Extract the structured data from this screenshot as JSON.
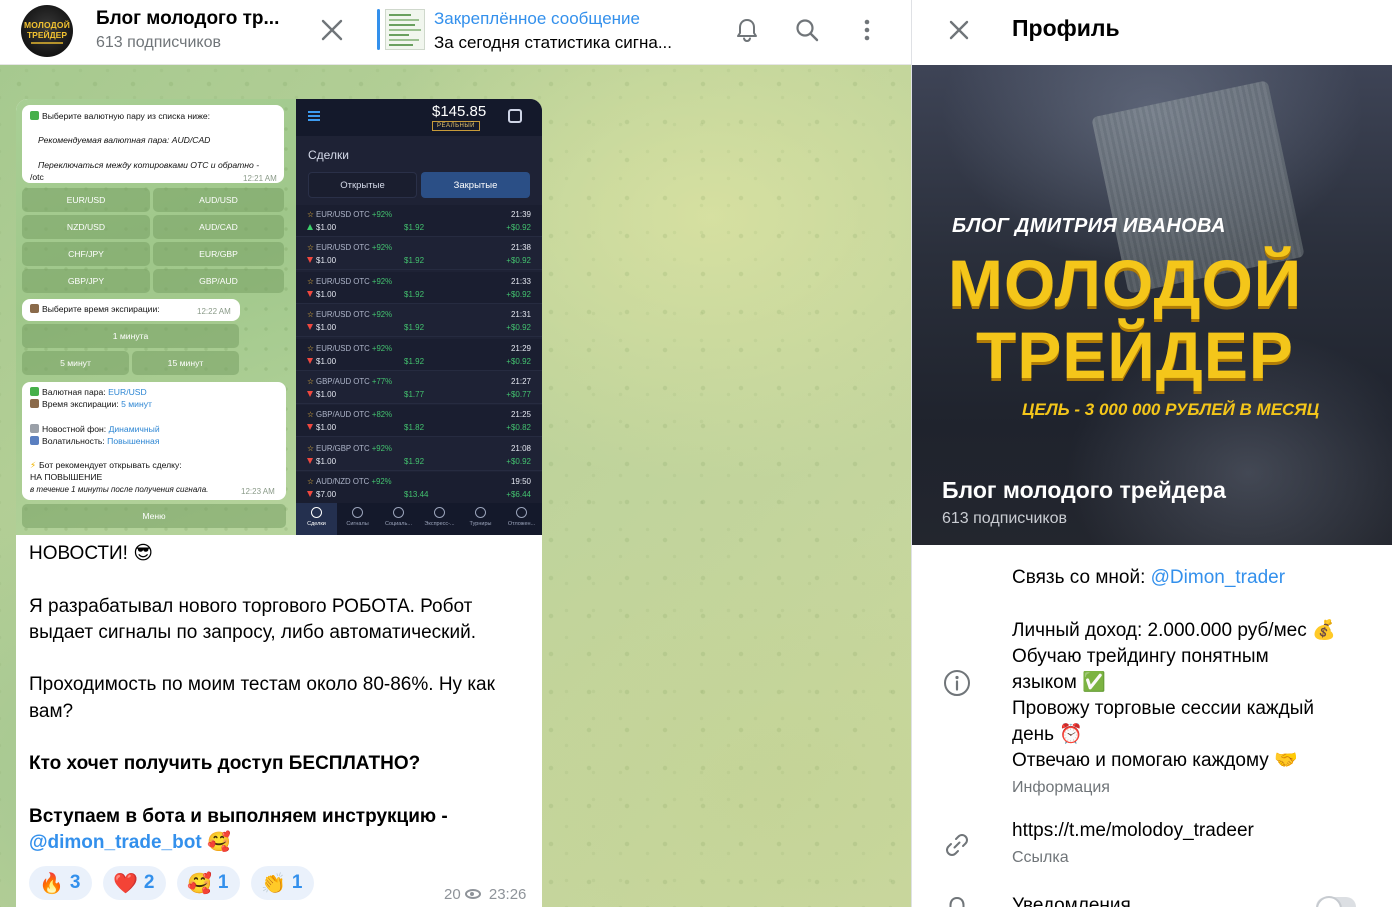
{
  "chat_header": {
    "avatar_line1": "МОЛОДОЙ",
    "avatar_line2": "ТРЕЙДЕР",
    "title": "Блог молодого тр...",
    "subscribers": "613 подписчиков",
    "pinned_title": "Закреплённое сообщение",
    "pinned_text": "За сегодня статистика сигна..."
  },
  "bot_screenshot": {
    "msg1_line1": "Выберите валютную пару из списка ниже:",
    "msg1_line2": "Рекомендуемая валютная пара: AUD/CAD",
    "msg1_line3": "Переключаться между котировками OTC и обратно -",
    "msg1_link": "/otc",
    "msg1_time": "12:21 AM",
    "pairs": [
      "EUR/USD",
      "AUD/USD",
      "NZD/USD",
      "AUD/CAD",
      "CHF/JPY",
      "EUR/GBP",
      "GBP/JPY",
      "GBP/AUD"
    ],
    "msg2_text": "Выберите время экспирации:",
    "msg2_time": "12:22 AM",
    "expiry_options": [
      "1 минута",
      "5 минут",
      "15 минут"
    ],
    "msg3_pair_label": "Валютная пара:",
    "msg3_pair_value": "EUR/USD",
    "msg3_expiry_label": "Время экспирации:",
    "msg3_expiry_value": "5 минут",
    "msg3_news_label": "Новостной фон:",
    "msg3_news_value": "Динамичный",
    "msg3_vol_label": "Волатильность:",
    "msg3_vol_value": "Повышенная",
    "msg3_rec": "Бот рекомендует открывать сделку:",
    "msg3_dir": "НА ПОВЫШЕНИЕ",
    "msg3_note": "в течение 1 минуты после получения сигнала.",
    "msg3_time": "12:23 AM",
    "menu_button": "Меню"
  },
  "trade_screenshot": {
    "balance": "$145.85",
    "account_type": "РЕАЛЬНЫЙ",
    "section": "Сделки",
    "tab_open": "Открытые",
    "tab_closed": "Закрытые",
    "trades": [
      {
        "pair": "EUR/USD OTC",
        "pct": "+92%",
        "time": "21:39",
        "amount": "$1.00",
        "dir": "up",
        "payout": "$1.92",
        "profit": "+$0.92"
      },
      {
        "pair": "EUR/USD OTC",
        "pct": "+92%",
        "time": "21:38",
        "amount": "$1.00",
        "dir": "down",
        "payout": "$1.92",
        "profit": "+$0.92"
      },
      {
        "pair": "EUR/USD OTC",
        "pct": "+92%",
        "time": "21:33",
        "amount": "$1.00",
        "dir": "down",
        "payout": "$1.92",
        "profit": "+$0.92"
      },
      {
        "pair": "EUR/USD OTC",
        "pct": "+92%",
        "time": "21:31",
        "amount": "$1.00",
        "dir": "down",
        "payout": "$1.92",
        "profit": "+$0.92"
      },
      {
        "pair": "EUR/USD OTC",
        "pct": "+92%",
        "time": "21:29",
        "amount": "$1.00",
        "dir": "down",
        "payout": "$1.92",
        "profit": "+$0.92"
      },
      {
        "pair": "GBP/AUD OTC",
        "pct": "+77%",
        "time": "21:27",
        "amount": "$1.00",
        "dir": "down",
        "payout": "$1.77",
        "profit": "+$0.77"
      },
      {
        "pair": "GBP/AUD OTC",
        "pct": "+82%",
        "time": "21:25",
        "amount": "$1.00",
        "dir": "down",
        "payout": "$1.82",
        "profit": "+$0.82"
      },
      {
        "pair": "EUR/GBP OTC",
        "pct": "+92%",
        "time": "21:08",
        "amount": "$1.00",
        "dir": "down",
        "payout": "$1.92",
        "profit": "+$0.92"
      },
      {
        "pair": "AUD/NZD OTC",
        "pct": "+92%",
        "time": "19:50",
        "amount": "$7.00",
        "dir": "down",
        "payout": "$13.44",
        "profit": "+$6.44"
      }
    ],
    "bottom_tabs": [
      "Сделки",
      "Сигналы",
      "Социаль...",
      "Экспресс-...",
      "Турниры",
      "Отложен..."
    ]
  },
  "message": {
    "line_news": "НОВОСТИ! 😎",
    "para1": "Я разрабатывал нового торгового РОБОТА. Робот выдает сигналы по запросу, либо автоматический.",
    "para2": "Проходимость по моим тестам около 80-86%. Ну как вам?",
    "para3": "Кто хочет получить доступ БЕСПЛАТНО?",
    "para4": "Вступаем в бота и выполняем инструкцию -",
    "mention": "@dimon_trade_bot",
    "mention_emoji": "🥰",
    "reactions": [
      {
        "emoji": "🔥",
        "count": "3"
      },
      {
        "emoji": "❤️",
        "count": "2"
      },
      {
        "emoji": "🥰",
        "count": "1"
      },
      {
        "emoji": "👏",
        "count": "1"
      }
    ],
    "views": "20",
    "time": "23:26"
  },
  "profile": {
    "title": "Профиль",
    "cover_line1": "БЛОГ ДМИТРИЯ ИВАНОВА",
    "cover_big1": "МОЛОДОЙ",
    "cover_big2": "ТРЕЙДЕР",
    "cover_goal": "ЦЕЛЬ - 3 000 000 РУБЛЕЙ В МЕСЯЦ",
    "name": "Блог молодого трейдера",
    "subscribers": "613 подписчиков",
    "contact_prefix": "Связь со мной: ",
    "contact_handle": "@Dimon_trader",
    "info_lines": [
      "Личный доход: 2.000.000 руб/мес 💰",
      "Обучаю трейдингу понятным",
      "языком ✅",
      "Провожу торговые сессии каждый",
      "день ⏰",
      "Отвечаю и помогаю каждому 🤝"
    ],
    "info_label": "Информация",
    "link": "https://t.me/molodoy_tradeer",
    "link_label": "Ссылка",
    "notifications_label": "Уведомления"
  }
}
